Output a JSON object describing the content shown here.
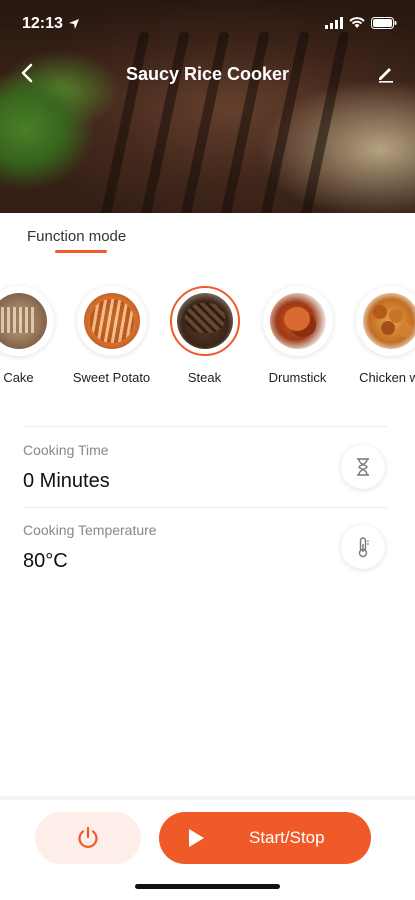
{
  "status_bar": {
    "time": "12:13"
  },
  "nav": {
    "title": "Saucy Rice Cooker"
  },
  "tab": {
    "label": "Function mode"
  },
  "modes": [
    {
      "label": "Cake",
      "icon": "cake-image"
    },
    {
      "label": "Sweet Potato",
      "icon": "sweet-potato-image"
    },
    {
      "label": "Steak",
      "icon": "steak-image",
      "selected": true
    },
    {
      "label": "Drumstick",
      "icon": "drumstick-image"
    },
    {
      "label": "Chicken wi",
      "icon": "chicken-wings-image"
    }
  ],
  "cooking_time": {
    "label": "Cooking Time",
    "value": "0 Minutes",
    "icon": "hourglass-icon"
  },
  "cooking_temperature": {
    "label": "Cooking Temperature",
    "value": "80°C",
    "icon": "thermometer-icon"
  },
  "actions": {
    "start_stop_label": "Start/Stop"
  },
  "colors": {
    "accent": "#f05a28",
    "power_bg": "#fdeee9"
  }
}
